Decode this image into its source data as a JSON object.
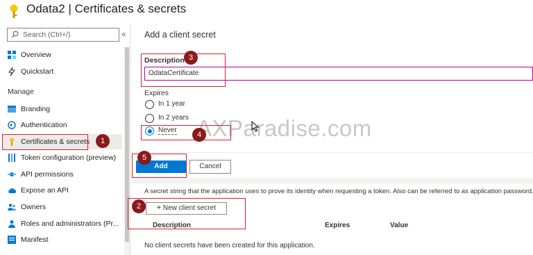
{
  "header": {
    "title": "Odata2 | Certificates & secrets"
  },
  "sidebar": {
    "search_placeholder": "Search (Ctrl+/)",
    "collapse_glyph": "«",
    "manage_label": "Manage",
    "items": [
      {
        "label": "Overview",
        "icon": "overview-icon"
      },
      {
        "label": "Quickstart",
        "icon": "quickstart-icon"
      },
      {
        "label": "Branding",
        "icon": "branding-icon"
      },
      {
        "label": "Authentication",
        "icon": "authentication-icon"
      },
      {
        "label": "Certificates & secrets",
        "icon": "key-icon",
        "active": true
      },
      {
        "label": "Token configuration (preview)",
        "icon": "token-icon"
      },
      {
        "label": "API permissions",
        "icon": "api-permissions-icon"
      },
      {
        "label": "Expose an API",
        "icon": "cloud-icon"
      },
      {
        "label": "Owners",
        "icon": "owners-icon"
      },
      {
        "label": "Roles and administrators (Pr...",
        "icon": "roles-icon"
      },
      {
        "label": "Manifest",
        "icon": "manifest-icon"
      }
    ]
  },
  "add_secret": {
    "title": "Add a client secret",
    "description_label": "Description",
    "description_value": "OdataCertificate",
    "expires_label": "Expires",
    "options": [
      "In 1 year",
      "In 2 years",
      "Never"
    ],
    "selected": "Never",
    "add_label": "Add",
    "cancel_label": "Cancel"
  },
  "secrets": {
    "info": "A secret string that the application uses to prove its identity when requesting a token. Also can be referred to as application password.",
    "new_button": "New client secret",
    "columns": [
      "Description",
      "Expires",
      "Value"
    ],
    "empty": "No client secrets have been created for this application."
  },
  "callouts": [
    "1",
    "2",
    "3",
    "4",
    "5"
  ],
  "watermark": "AXParadise.com",
  "colors": {
    "accent": "#0078d4",
    "callout": "#e01e2e",
    "badge": "#8b1a1a",
    "focus": "#b4009e"
  }
}
